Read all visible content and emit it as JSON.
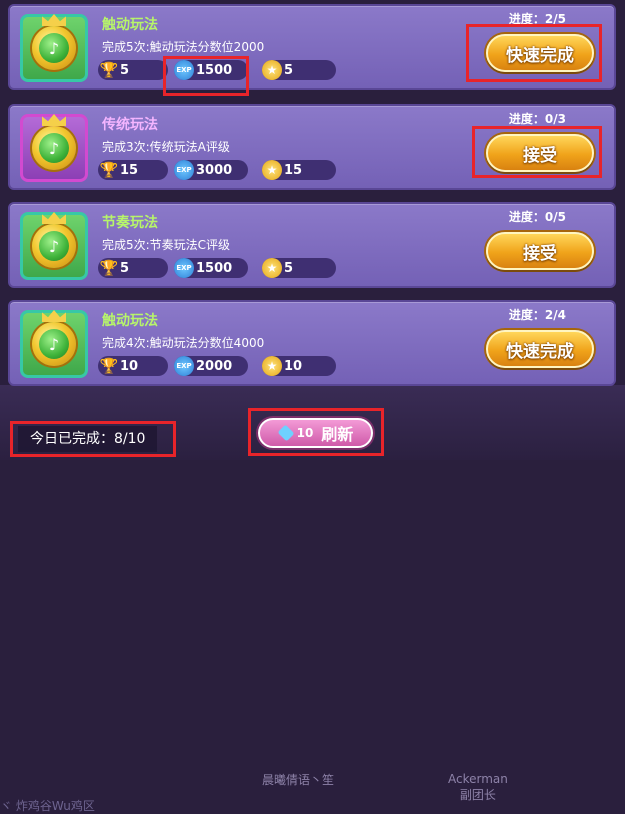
{
  "background": {
    "text1": "晨曦倩语丶笙",
    "text2_line1": "Ackerman",
    "text2_line2": "副团长",
    "text3": "ヾ 炸鸡谷Wu鸡区"
  },
  "tasks": [
    {
      "title": "触动玩法",
      "description": "完成5次:触动玩法分数位2000",
      "trophy": "5",
      "exp": "1500",
      "star": "5",
      "progress": "进度：2/5",
      "button": "快速完成"
    },
    {
      "title": "传统玩法",
      "description": "完成3次:传统玩法A评级",
      "trophy": "15",
      "exp": "3000",
      "star": "15",
      "progress": "进度：0/3",
      "button": "接受"
    },
    {
      "title": "节奏玩法",
      "description": "完成5次:节奏玩法C评级",
      "trophy": "5",
      "exp": "1500",
      "star": "5",
      "progress": "进度：0/5",
      "button": "接受"
    },
    {
      "title": "触动玩法",
      "description": "完成4次:触动玩法分数位4000",
      "trophy": "10",
      "exp": "2000",
      "star": "10",
      "progress": "进度：2/4",
      "button": "快速完成"
    }
  ],
  "footer": {
    "completed_today": "今日已完成：8/10",
    "refresh_cost": "10",
    "refresh_label": "刷新"
  },
  "icons": {
    "trophy": "trophy-icon",
    "exp": "exp-icon",
    "star": "star-medal-icon",
    "gem": "diamond-icon",
    "task": "music-medal-icon"
  },
  "colors": {
    "card": "#7f6cc0",
    "title_green": "#b7f56a",
    "title_pink": "#f4b5ff",
    "button": "#f0a31a",
    "highlight": "#e8242a"
  }
}
